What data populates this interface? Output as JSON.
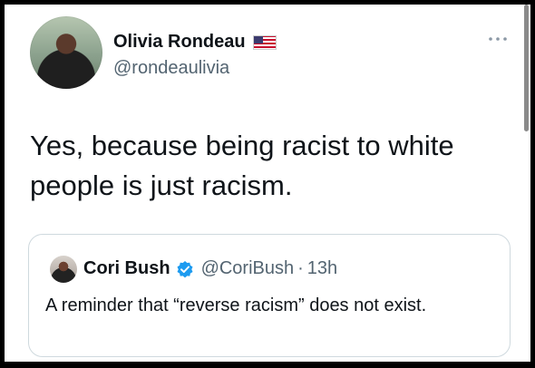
{
  "tweet": {
    "author": {
      "display_name": "Olivia Rondeau",
      "handle": "@rondeaulivia",
      "flag_icon": "us-flag-icon"
    },
    "text": "Yes, because being racist to white people is just racism."
  },
  "quoted_tweet": {
    "author": {
      "display_name": "Cori Bush",
      "handle": "@CoriBush",
      "verified_icon": "verified-badge-icon"
    },
    "separator": "·",
    "time": "13h",
    "text": "A reminder that “reverse racism” does not exist."
  },
  "icons": {
    "more": "more-options-icon",
    "accent": "#1d9bf0"
  }
}
